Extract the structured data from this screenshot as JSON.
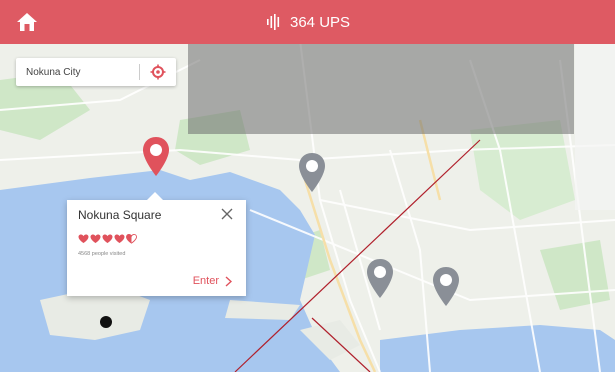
{
  "header": {
    "home_icon": "home-icon",
    "ups_icon": "bars-icon",
    "ups_text": "364 UPS"
  },
  "search": {
    "value": "Nokuna City",
    "locate_icon": "locate-icon"
  },
  "place_card": {
    "title": "Nokuna Square",
    "rating": 4.5,
    "visited_text": "4568 people visited",
    "enter_label": "Enter",
    "enter_icon": "chevron-right-icon",
    "close_icon": "close-icon"
  },
  "colors": {
    "accent": "#de5a63",
    "water": "#a7c7ef",
    "land": "#eef0ea",
    "park": "#bde3b6",
    "pin_active": "#e0525c",
    "pin_inactive": "#8a8f97"
  }
}
